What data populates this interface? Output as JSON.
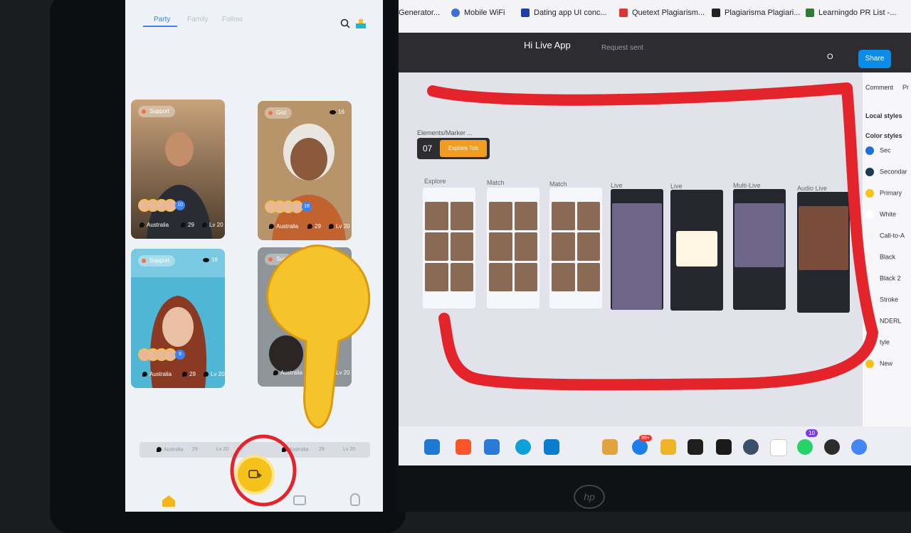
{
  "phone": {
    "tabs": [
      "Party",
      "Family",
      "Follow"
    ],
    "cards": [
      {
        "tag": "Support",
        "viewers": "",
        "count": "10",
        "location": "Australia",
        "number": "29",
        "level": "Lv 20"
      },
      {
        "tag": "Gist",
        "viewers": "16",
        "count": "18",
        "location": "Australia",
        "number": "29",
        "level": "Lv 20"
      },
      {
        "tag": "Support",
        "viewers": "16",
        "count": "9",
        "location": "Australia",
        "number": "29",
        "level": "Lv 20"
      },
      {
        "tag": "Sup",
        "viewers": "",
        "count": "",
        "location": "Australia",
        "number": "29",
        "level": "Lv 20"
      }
    ],
    "bottom_strip": {
      "location_1": "Australia",
      "number_1": "29",
      "level_1": "Lv 20",
      "location_2": "Australia",
      "number_2": "29",
      "level_2": "Lv 20"
    },
    "accent_color": "#f5c21b"
  },
  "browser": {
    "bookmarks": [
      "Generator...",
      "Mobile WiFi",
      "Dating app UI conc...",
      "Quetext Plagiarism...",
      "Plagiarisma Plagiari...",
      "Learningdo PR List -..."
    ]
  },
  "figma": {
    "file_title": "Hi Live App",
    "status": "Request sent",
    "share_label": "Share",
    "avatar_letter": "O",
    "frame_label": "Elements/Marker ...",
    "marker_number": "07",
    "marker_tag": "Explore Tob",
    "thumbnails": [
      "Explore",
      "Match",
      "Match",
      "Live",
      "Live",
      "Multi-Live",
      "Audio Live"
    ],
    "panel": {
      "tab_comment": "Comment",
      "tab_prototype": "Pr",
      "local_styles": "Local styles",
      "color_styles": "Color styles",
      "colors": [
        {
          "name": "Sec",
          "hex": "#1e6fd9"
        },
        {
          "name": "Secondar",
          "hex": "#1c3a52"
        },
        {
          "name": "Primary",
          "hex": "#f5c21b"
        },
        {
          "name": "White",
          "hex": "#ffffff"
        },
        {
          "name": "Call-to-A",
          "hex": "#f5f5f5"
        },
        {
          "name": "Black",
          "hex": "#f5f5f5"
        },
        {
          "name": "Black 2",
          "hex": "#f5f5f5"
        },
        {
          "name": "Stroke",
          "hex": "#f5f5f5"
        },
        {
          "name": "NDERL",
          "hex": "#f5f5f5"
        },
        {
          "name": "tyle",
          "hex": "#f5f5f5"
        },
        {
          "name": "New",
          "hex": "#f5c21b"
        }
      ]
    },
    "taskbar_badges": {
      "brave_badge": "99+",
      "whatsapp_badge": "10"
    }
  },
  "laptop_brand": "hp"
}
